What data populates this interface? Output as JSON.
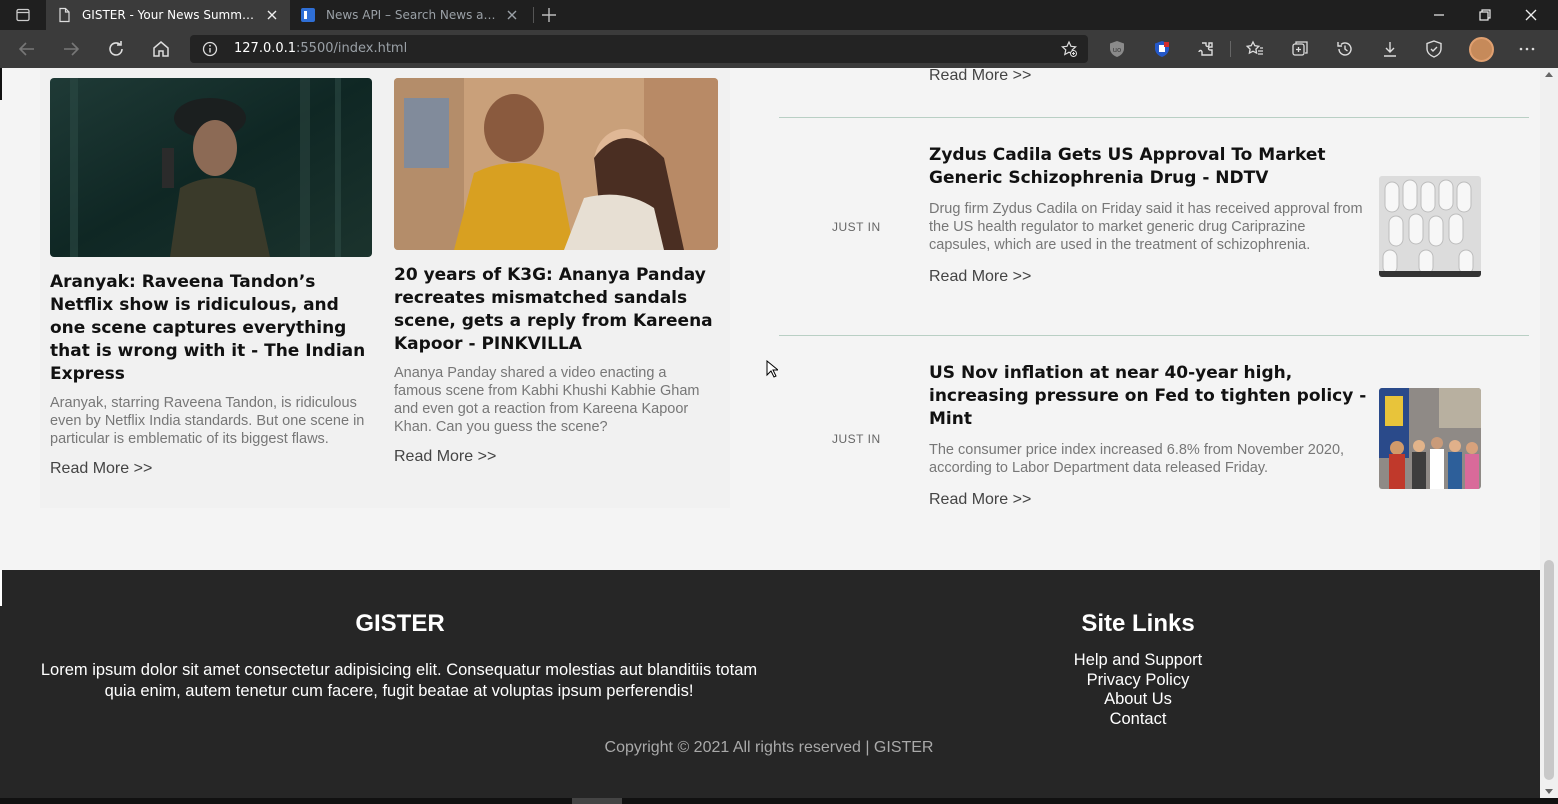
{
  "browser": {
    "tabs": [
      {
        "title": "GISTER - Your News Summary",
        "active": true
      },
      {
        "title": "News API – Search News and Blog Articles on the Web",
        "active": false
      }
    ],
    "url_host": "127.0.0.1",
    "url_path": ":5500/index.html",
    "icons": [
      "tab-actions-icon",
      "back-icon",
      "forward-icon",
      "refresh-icon",
      "home-icon",
      "info-icon",
      "favorite-add-icon",
      "ublock-icon",
      "extension-shield-icon",
      "extensions-icon",
      "favorites-icon",
      "collections-icon",
      "history-icon",
      "downloads-icon",
      "performance-icon",
      "profile-avatar",
      "more-icon",
      "minimize-icon",
      "restore-icon",
      "close-window-icon"
    ]
  },
  "top_right_read_more": "Read More >>",
  "cards": [
    {
      "title": "Aranyak: Raveena Tandon’s Netflix show is ridiculous, and one scene captures everything that is wrong with it - The Indian Express",
      "description": "Aranyak, starring Raveena Tandon, is ridiculous even by Netflix India standards. But one scene in particular is emblematic of its biggest flaws.",
      "read_more": "Read More >>"
    },
    {
      "title": "20 years of K3G: Ananya Panday recreates mismatched sandals scene, gets a reply from Kareena Kapoor - PINKVILLA",
      "description": "Ananya Panday shared a video enacting a famous scene from Kabhi Khushi Kabhie Gham and even got a reaction from Kareena Kapoor Khan. Can you guess the scene?",
      "read_more": "Read More >>"
    }
  ],
  "list": [
    {
      "badge": "JUST IN",
      "title": "Zydus Cadila Gets US Approval To Market Generic Schizophrenia Drug - NDTV",
      "description": "Drug firm Zydus Cadila on Friday said it has received approval from the US health regulator to market generic drug Cariprazine capsules, which are used in the treatment of schizophrenia.",
      "read_more": "Read More >>"
    },
    {
      "badge": "JUST IN",
      "title": "US Nov inflation at near 40-year high, increasing pressure on Fed to tighten policy - Mint",
      "description": "The consumer price index increased 6.8% from November 2020, according to Labor Department data released Friday.",
      "read_more": "Read More >>"
    }
  ],
  "footer": {
    "brand": "GISTER",
    "about": "Lorem ipsum dolor sit amet consectetur adipisicing elit. Consequatur molestias aut blanditiis totam quia enim, autem tenetur cum facere, fugit beatae at voluptas ipsum perferendis!",
    "links_title": "Site Links",
    "links": [
      "Help and Support",
      "Privacy Policy",
      "About Us",
      "Contact"
    ],
    "copyright": "Copyright © 2021 All rights reserved | GISTER"
  }
}
